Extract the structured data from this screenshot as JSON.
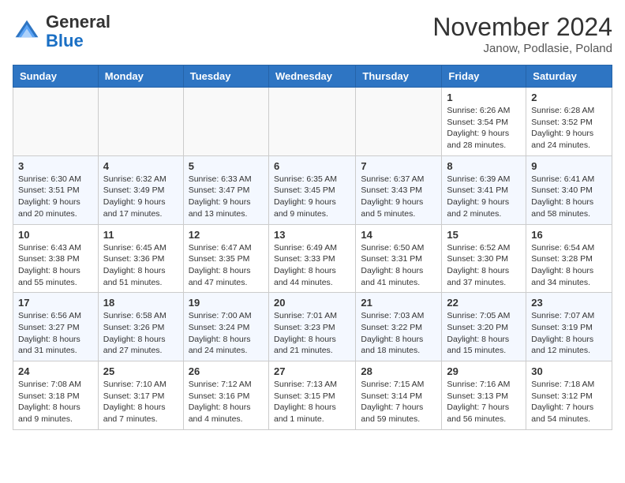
{
  "header": {
    "logo": {
      "general": "General",
      "blue": "Blue"
    },
    "title": "November 2024",
    "location": "Janow, Podlasie, Poland"
  },
  "columns": [
    "Sunday",
    "Monday",
    "Tuesday",
    "Wednesday",
    "Thursday",
    "Friday",
    "Saturday"
  ],
  "weeks": [
    [
      {
        "day": "",
        "info": ""
      },
      {
        "day": "",
        "info": ""
      },
      {
        "day": "",
        "info": ""
      },
      {
        "day": "",
        "info": ""
      },
      {
        "day": "",
        "info": ""
      },
      {
        "day": "1",
        "info": "Sunrise: 6:26 AM\nSunset: 3:54 PM\nDaylight: 9 hours and 28 minutes."
      },
      {
        "day": "2",
        "info": "Sunrise: 6:28 AM\nSunset: 3:52 PM\nDaylight: 9 hours and 24 minutes."
      }
    ],
    [
      {
        "day": "3",
        "info": "Sunrise: 6:30 AM\nSunset: 3:51 PM\nDaylight: 9 hours and 20 minutes."
      },
      {
        "day": "4",
        "info": "Sunrise: 6:32 AM\nSunset: 3:49 PM\nDaylight: 9 hours and 17 minutes."
      },
      {
        "day": "5",
        "info": "Sunrise: 6:33 AM\nSunset: 3:47 PM\nDaylight: 9 hours and 13 minutes."
      },
      {
        "day": "6",
        "info": "Sunrise: 6:35 AM\nSunset: 3:45 PM\nDaylight: 9 hours and 9 minutes."
      },
      {
        "day": "7",
        "info": "Sunrise: 6:37 AM\nSunset: 3:43 PM\nDaylight: 9 hours and 5 minutes."
      },
      {
        "day": "8",
        "info": "Sunrise: 6:39 AM\nSunset: 3:41 PM\nDaylight: 9 hours and 2 minutes."
      },
      {
        "day": "9",
        "info": "Sunrise: 6:41 AM\nSunset: 3:40 PM\nDaylight: 8 hours and 58 minutes."
      }
    ],
    [
      {
        "day": "10",
        "info": "Sunrise: 6:43 AM\nSunset: 3:38 PM\nDaylight: 8 hours and 55 minutes."
      },
      {
        "day": "11",
        "info": "Sunrise: 6:45 AM\nSunset: 3:36 PM\nDaylight: 8 hours and 51 minutes."
      },
      {
        "day": "12",
        "info": "Sunrise: 6:47 AM\nSunset: 3:35 PM\nDaylight: 8 hours and 47 minutes."
      },
      {
        "day": "13",
        "info": "Sunrise: 6:49 AM\nSunset: 3:33 PM\nDaylight: 8 hours and 44 minutes."
      },
      {
        "day": "14",
        "info": "Sunrise: 6:50 AM\nSunset: 3:31 PM\nDaylight: 8 hours and 41 minutes."
      },
      {
        "day": "15",
        "info": "Sunrise: 6:52 AM\nSunset: 3:30 PM\nDaylight: 8 hours and 37 minutes."
      },
      {
        "day": "16",
        "info": "Sunrise: 6:54 AM\nSunset: 3:28 PM\nDaylight: 8 hours and 34 minutes."
      }
    ],
    [
      {
        "day": "17",
        "info": "Sunrise: 6:56 AM\nSunset: 3:27 PM\nDaylight: 8 hours and 31 minutes."
      },
      {
        "day": "18",
        "info": "Sunrise: 6:58 AM\nSunset: 3:26 PM\nDaylight: 8 hours and 27 minutes."
      },
      {
        "day": "19",
        "info": "Sunrise: 7:00 AM\nSunset: 3:24 PM\nDaylight: 8 hours and 24 minutes."
      },
      {
        "day": "20",
        "info": "Sunrise: 7:01 AM\nSunset: 3:23 PM\nDaylight: 8 hours and 21 minutes."
      },
      {
        "day": "21",
        "info": "Sunrise: 7:03 AM\nSunset: 3:22 PM\nDaylight: 8 hours and 18 minutes."
      },
      {
        "day": "22",
        "info": "Sunrise: 7:05 AM\nSunset: 3:20 PM\nDaylight: 8 hours and 15 minutes."
      },
      {
        "day": "23",
        "info": "Sunrise: 7:07 AM\nSunset: 3:19 PM\nDaylight: 8 hours and 12 minutes."
      }
    ],
    [
      {
        "day": "24",
        "info": "Sunrise: 7:08 AM\nSunset: 3:18 PM\nDaylight: 8 hours and 9 minutes."
      },
      {
        "day": "25",
        "info": "Sunrise: 7:10 AM\nSunset: 3:17 PM\nDaylight: 8 hours and 7 minutes."
      },
      {
        "day": "26",
        "info": "Sunrise: 7:12 AM\nSunset: 3:16 PM\nDaylight: 8 hours and 4 minutes."
      },
      {
        "day": "27",
        "info": "Sunrise: 7:13 AM\nSunset: 3:15 PM\nDaylight: 8 hours and 1 minute."
      },
      {
        "day": "28",
        "info": "Sunrise: 7:15 AM\nSunset: 3:14 PM\nDaylight: 7 hours and 59 minutes."
      },
      {
        "day": "29",
        "info": "Sunrise: 7:16 AM\nSunset: 3:13 PM\nDaylight: 7 hours and 56 minutes."
      },
      {
        "day": "30",
        "info": "Sunrise: 7:18 AM\nSunset: 3:12 PM\nDaylight: 7 hours and 54 minutes."
      }
    ]
  ]
}
